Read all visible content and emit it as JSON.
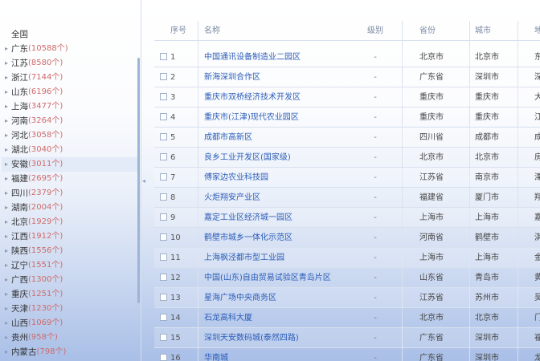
{
  "sidebar": {
    "items": [
      {
        "name": "全国",
        "count": "",
        "selected": false
      },
      {
        "name": "广东",
        "count": "10588个",
        "selected": false
      },
      {
        "name": "江苏",
        "count": "8580个",
        "selected": false
      },
      {
        "name": "浙江",
        "count": "7144个",
        "selected": false
      },
      {
        "name": "山东",
        "count": "6196个",
        "selected": false
      },
      {
        "name": "上海",
        "count": "3477个",
        "selected": false
      },
      {
        "name": "河南",
        "count": "3264个",
        "selected": false
      },
      {
        "name": "河北",
        "count": "3058个",
        "selected": false
      },
      {
        "name": "湖北",
        "count": "3040个",
        "selected": false
      },
      {
        "name": "安徽",
        "count": "3011个",
        "selected": true
      },
      {
        "name": "福建",
        "count": "2695个",
        "selected": false
      },
      {
        "name": "四川",
        "count": "2379个",
        "selected": false
      },
      {
        "name": "湖南",
        "count": "2004个",
        "selected": false
      },
      {
        "name": "北京",
        "count": "1929个",
        "selected": false
      },
      {
        "name": "江西",
        "count": "1912个",
        "selected": false
      },
      {
        "name": "陕西",
        "count": "1556个",
        "selected": false
      },
      {
        "name": "辽宁",
        "count": "1551个",
        "selected": false
      },
      {
        "name": "广西",
        "count": "1300个",
        "selected": false
      },
      {
        "name": "重庆",
        "count": "1251个",
        "selected": false
      },
      {
        "name": "天津",
        "count": "1230个",
        "selected": false
      },
      {
        "name": "山西",
        "count": "1069个",
        "selected": false
      },
      {
        "name": "贵州",
        "count": "958个",
        "selected": false
      },
      {
        "name": "内蒙古",
        "count": "798个",
        "selected": false
      }
    ]
  },
  "table": {
    "headers": {
      "idx": "序号",
      "name": "名称",
      "dash": "级别",
      "prov": "省份",
      "city": "城市",
      "ext": "地址"
    },
    "rows": [
      {
        "idx": "1",
        "name": "中国通讯设备制造业二园区",
        "dash": "-",
        "prov": "北京市",
        "city": "北京市",
        "ext": "东"
      },
      {
        "idx": "2",
        "name": "新海深圳合作区",
        "dash": "-",
        "prov": "广东省",
        "city": "深圳市",
        "ext": "深"
      },
      {
        "idx": "3",
        "name": "重庆市双桥经济技术开发区",
        "dash": "-",
        "prov": "重庆市",
        "city": "重庆市",
        "ext": "大"
      },
      {
        "idx": "4",
        "name": "重庆市(江津)现代农业园区",
        "dash": "-",
        "prov": "重庆市",
        "city": "重庆市",
        "ext": "江"
      },
      {
        "idx": "5",
        "name": "成都市高新区",
        "dash": "-",
        "prov": "四川省",
        "city": "成都市",
        "ext": "成"
      },
      {
        "idx": "6",
        "name": "良乡工业开发区(国家级)",
        "dash": "-",
        "prov": "北京市",
        "city": "北京市",
        "ext": "房"
      },
      {
        "idx": "7",
        "name": "傅家边农业科技园",
        "dash": "-",
        "prov": "江苏省",
        "city": "南京市",
        "ext": "溧"
      },
      {
        "idx": "8",
        "name": "火炬翔安产业区",
        "dash": "-",
        "prov": "福建省",
        "city": "厦门市",
        "ext": "翔"
      },
      {
        "idx": "9",
        "name": "嘉定工业区经济城一园区",
        "dash": "-",
        "prov": "上海市",
        "city": "上海市",
        "ext": "嘉"
      },
      {
        "idx": "10",
        "name": "鹤壁市城乡一体化示范区",
        "dash": "-",
        "prov": "河南省",
        "city": "鹤壁市",
        "ext": "淇"
      },
      {
        "idx": "11",
        "name": "上海枫泾都市型工业园",
        "dash": "-",
        "prov": "上海市",
        "city": "上海市",
        "ext": "金"
      },
      {
        "idx": "12",
        "name": "中国(山东)自由贸易试验区青岛片区",
        "dash": "-",
        "prov": "山东省",
        "city": "青岛市",
        "ext": "黄"
      },
      {
        "idx": "13",
        "name": "星海广场中央商务区",
        "dash": "-",
        "prov": "江苏省",
        "city": "苏州市",
        "ext": "吴"
      },
      {
        "idx": "14",
        "name": "石龙高科大厦",
        "dash": "-",
        "prov": "北京市",
        "city": "北京市",
        "ext": "门"
      },
      {
        "idx": "15",
        "name": "深圳天安数码城(泰然四路)",
        "dash": "-",
        "prov": "广东省",
        "city": "深圳市",
        "ext": "福"
      },
      {
        "idx": "16",
        "name": "华南城",
        "dash": "-",
        "prov": "广东省",
        "city": "深圳市",
        "ext": "龙"
      }
    ]
  },
  "icons": {
    "expand": "caret-right-icon",
    "collapse": "collapse-handle-icon"
  }
}
